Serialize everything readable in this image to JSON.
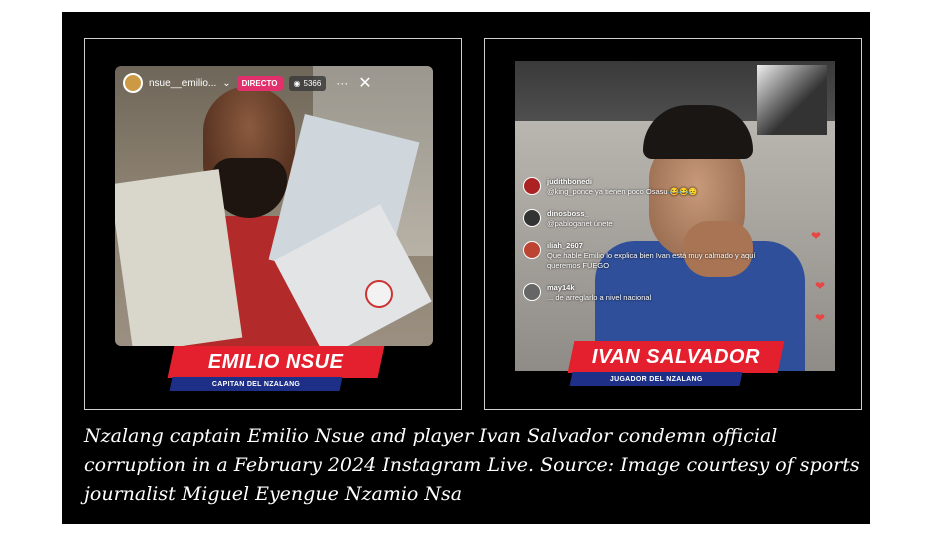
{
  "left_panel": {
    "username": "nsue__emilio...",
    "live_badge": "DIRECTO",
    "viewers": "5366",
    "name": "EMILIO NSUE",
    "role": "CAPITAN DEL NZALANG",
    "icons": [
      "chevron-down-icon",
      "eye-icon",
      "more-icon",
      "close-icon"
    ]
  },
  "right_panel": {
    "comments": [
      {
        "user": "judithbonedi",
        "text": "@king_ponce ya tienen poco Osasu 😂😂😥"
      },
      {
        "user": "dinosboss_",
        "text": "@pabloganet únete"
      },
      {
        "user": "iliah_2607",
        "text": "Que hable Emilio lo explica bien Ivan está muy calmado y aquí queremos FUEGO"
      },
      {
        "user": "may14k",
        "text": "... de arreglarlo a nivel nacional"
      }
    ],
    "name": "IVAN SALVADOR",
    "role": "JUGADOR DEL NZALANG",
    "colors": {
      "heart": "#e84545"
    }
  },
  "banner_colors": {
    "red": "#e4202e",
    "blue": "#1d2f86"
  },
  "caption": "Nzalang captain Emilio Nsue and player Ivan Salvador condemn official corruption in a February 2024 Instagram Live.  Source: Image courtesy of sports journalist Miguel Eyengue Nzamio Nsa"
}
